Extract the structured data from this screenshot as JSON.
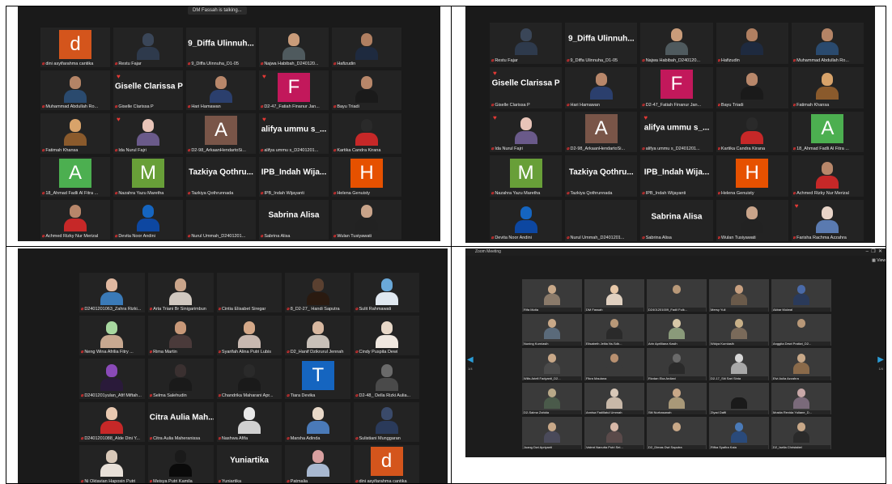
{
  "q1": {
    "talking": "DM Fassah is talking...",
    "tiles": [
      {
        "label": "dini asyifarahma cantika",
        "type": "letter",
        "letter": "d",
        "color": "#d4551c"
      },
      {
        "label": "Restu Fajar",
        "type": "photo",
        "skin": "#3a4658",
        "shirt": "#2e3a4c"
      },
      {
        "label": "9_Diffa Ulinnuha_D1-05",
        "type": "name",
        "name": "9_Diffa Ulinnuh..."
      },
      {
        "label": "Najwa Habibah_D240120...",
        "type": "photo",
        "skin": "#c99c7a",
        "shirt": "#4f5a5e"
      },
      {
        "label": "Hafizudin",
        "type": "photo",
        "skin": "#b07f61",
        "shirt": "#1e2a3f"
      },
      {
        "label": "Muhammad Abdullah Ro...",
        "type": "photo",
        "skin": "#b48466",
        "shirt": "#2a4a6e"
      },
      {
        "label": "Giselle Clarissa P",
        "type": "name",
        "name": "Giselle Clarissa P",
        "heart": true
      },
      {
        "label": "Hari Hamawan",
        "type": "photo",
        "skin": "#b8876a",
        "shirt": "#2b3f6d"
      },
      {
        "label": "D2-47_Fatiah Finanur Jan...",
        "type": "letter",
        "letter": "F",
        "color": "#c2185b",
        "heart": true
      },
      {
        "label": "Bayu Triadi",
        "type": "photo",
        "skin": "#b8876a",
        "shirt": "#1a1a1a"
      },
      {
        "label": "Fatimah Khansa",
        "type": "photo",
        "skin": "#d8a36a",
        "shirt": "#8a5a2c"
      },
      {
        "label": "Ida Nurul Fajri",
        "type": "photo",
        "skin": "#e8c4b8",
        "shirt": "#6a5a8a",
        "heart": true
      },
      {
        "label": "D2-98_ArkaanHendartoSi...",
        "type": "letter",
        "letter": "A",
        "color": "#795548"
      },
      {
        "label": "alifya ummu s_D2401201...",
        "type": "name",
        "name": "alifya ummu s_...",
        "heart": true
      },
      {
        "label": "Kartika Candra Kirana",
        "type": "photo",
        "skin": "#2a2a2a",
        "shirt": "#c62828"
      },
      {
        "label": "18_Ahmad Fadli Al Fitra ...",
        "type": "letter",
        "letter": "A",
        "color": "#4caf50"
      },
      {
        "label": "Nazahra Yazu Maretha",
        "type": "letter",
        "letter": "M",
        "color": "#689f38"
      },
      {
        "label": "Tazkiya Qothrunnada",
        "type": "name",
        "name": "Tazkiya Qothru..."
      },
      {
        "label": "IPB_Indah Wijayanti",
        "type": "name",
        "name": "IPB_Indah Wija..."
      },
      {
        "label": "Helena Genuisty",
        "type": "letter",
        "letter": "H",
        "color": "#e65100"
      },
      {
        "label": "Achmed Rizky Nur Merizal",
        "type": "photo",
        "skin": "#b8876a",
        "shirt": "#c62828"
      },
      {
        "label": "Devita Noor Andini",
        "type": "photo",
        "skin": "#1565c0",
        "shirt": "#0d47a1"
      },
      {
        "label": "Nurul Ummah_D2401201...",
        "type": "blank"
      },
      {
        "label": "Sabrina Alisa",
        "type": "name",
        "name": "Sabrina Alisa"
      },
      {
        "label": "Wulan Tusiyawati",
        "type": "photo",
        "skin": "#c9a48a",
        "shirt": "#222"
      }
    ]
  },
  "q2": {
    "tiles": [
      {
        "label": "Restu Fajar",
        "type": "photo",
        "skin": "#3a4658",
        "shirt": "#2e3a4c"
      },
      {
        "label": "9_Diffa Ulinnuha_D1-05",
        "type": "name",
        "name": "9_Diffa Ulinnuh..."
      },
      {
        "label": "Najwa Habibah_D240120...",
        "type": "photo",
        "skin": "#c99c7a",
        "shirt": "#4f5a5e"
      },
      {
        "label": "Hafizudin",
        "type": "photo",
        "skin": "#b07f61",
        "shirt": "#1e2a3f"
      },
      {
        "label": "Muhammad Abdullah Ro...",
        "type": "photo",
        "skin": "#b48466",
        "shirt": "#2a4a6e"
      },
      {
        "label": "Giselle Clarissa P",
        "type": "name",
        "name": "Giselle Clarissa P",
        "heart": true
      },
      {
        "label": "Hari Hamawan",
        "type": "photo",
        "skin": "#b8876a",
        "shirt": "#2b3f6d"
      },
      {
        "label": "D2-47_Fatiah Finanur Jan...",
        "type": "letter",
        "letter": "F",
        "color": "#c2185b"
      },
      {
        "label": "Bayu Triadi",
        "type": "photo",
        "skin": "#b8876a",
        "shirt": "#1a1a1a"
      },
      {
        "label": "Fatimah Khansa",
        "type": "photo",
        "skin": "#d8a36a",
        "shirt": "#8a5a2c"
      },
      {
        "label": "Ida Nurul Fajri",
        "type": "photo",
        "skin": "#e8c4b8",
        "shirt": "#6a5a8a",
        "heart": true
      },
      {
        "label": "D2-98_ArkaanHendartoSi...",
        "type": "letter",
        "letter": "A",
        "color": "#795548"
      },
      {
        "label": "alifya ummu s_D2401201...",
        "type": "name",
        "name": "alifya ummu s_...",
        "heart": true
      },
      {
        "label": "Kartika Candra Kirana",
        "type": "photo",
        "skin": "#2a2a2a",
        "shirt": "#c62828"
      },
      {
        "label": "18_Ahmad Fadli Al Fitra ...",
        "type": "letter",
        "letter": "A",
        "color": "#4caf50"
      },
      {
        "label": "Nazahra Yazu Maretha",
        "type": "letter",
        "letter": "M",
        "color": "#689f38"
      },
      {
        "label": "Tazkiya Qothrunnada",
        "type": "name",
        "name": "Tazkiya Qothru..."
      },
      {
        "label": "IPB_Indah Wijayanti",
        "type": "name",
        "name": "IPB_Indah Wija..."
      },
      {
        "label": "Helena Genuisty",
        "type": "letter",
        "letter": "H",
        "color": "#e65100"
      },
      {
        "label": "Achmed Rizky Nur Merizal",
        "type": "photo",
        "skin": "#b8876a",
        "shirt": "#c62828"
      },
      {
        "label": "Devita Noor Andini",
        "type": "photo",
        "skin": "#1565c0",
        "shirt": "#0d47a1"
      },
      {
        "label": "Nurul Ummah_D2401201...",
        "type": "blank"
      },
      {
        "label": "Sabrina Alisa",
        "type": "name",
        "name": "Sabrina Alisa"
      },
      {
        "label": "Wulan Tusiyawati",
        "type": "photo",
        "skin": "#c9a48a",
        "shirt": "#222"
      },
      {
        "label": "Farisha Rachma Azzahra",
        "type": "photo",
        "skin": "#e8d4c8",
        "shirt": "#5a7ab0",
        "heart": true
      }
    ]
  },
  "q3": {
    "tiles": [
      {
        "label": "D2401201063_Zahra Rizki...",
        "type": "photo",
        "skin": "#e0b8a0",
        "shirt": "#3a7ab8"
      },
      {
        "label": "Arta Triani Br Sinigarimbun",
        "type": "photo",
        "skin": "#c9a48a",
        "shirt": "#d0c8c0"
      },
      {
        "label": "Cintia Elisabet Siregar",
        "type": "blank"
      },
      {
        "label": "8_D2-27_ Handi Saputra",
        "type": "photo",
        "skin": "#5a4030",
        "shirt": "#2a1a10"
      },
      {
        "label": "Sulit Rahmawati",
        "type": "photo",
        "skin": "#6aa8d8",
        "shirt": "#e0e8f0"
      },
      {
        "label": "Neng Wina Afrilia Fitry ...",
        "type": "photo",
        "skin": "#a8d8a0",
        "shirt": "#c8a890"
      },
      {
        "label": "Rima Martin",
        "type": "photo",
        "skin": "#c89878",
        "shirt": "#4a3a3a"
      },
      {
        "label": "Syarifah Alina Putri Lubis",
        "type": "photo",
        "skin": "#d4a888",
        "shirt": "#c8b8b0"
      },
      {
        "label": "D2_Hanif Dzikrurul Jennah",
        "type": "photo",
        "skin": "#d8b8a0",
        "shirt": "#c8c0b8"
      },
      {
        "label": "Cindy Puspita Dewi",
        "type": "photo",
        "skin": "#e8d8c8",
        "shirt": "#f0e8e0"
      },
      {
        "label": "D2401201yulan_Afif Miftah...",
        "type": "photo",
        "skin": "#8a4ab8",
        "shirt": "#2a1a3a"
      },
      {
        "label": "Selma Salehudin",
        "type": "photo",
        "skin": "#3a3030",
        "shirt": "#1a1a1a"
      },
      {
        "label": "Chandrika Maharani Apr...",
        "type": "photo",
        "skin": "#2a2a2a",
        "shirt": "#1a1a1a"
      },
      {
        "label": "Tiara Devika",
        "type": "letter",
        "letter": "T",
        "color": "#1565c0"
      },
      {
        "label": "D2-48_ Della Rizki Aulia...",
        "type": "photo",
        "skin": "#6a6a6a",
        "shirt": "#4a4a4a"
      },
      {
        "label": "D2401201088_Alde Dini Y...",
        "type": "photo",
        "skin": "#e8c8b0",
        "shirt": "#c62828"
      },
      {
        "label": "Citra Aulia Maheranissa",
        "type": "name",
        "name": "Citra Aulia Mah..."
      },
      {
        "label": "Nashwa Afifa",
        "type": "photo",
        "skin": "#e8e8e8",
        "shirt": "#d0d0d0"
      },
      {
        "label": "Marsha Adinda",
        "type": "photo",
        "skin": "#e8d8c8",
        "shirt": "#4a7ab8"
      },
      {
        "label": "Sulistiani Munggaran",
        "type": "photo",
        "skin": "#3a4a6a",
        "shirt": "#2a3a5a"
      },
      {
        "label": "Ni Oktavian Haposin Putri",
        "type": "photo",
        "skin": "#d8c8b8",
        "shirt": "#e8e0d8"
      },
      {
        "label": "Meisya Putri Kamila",
        "type": "photo",
        "skin": "#1a1a1a",
        "shirt": "#0a0a0a"
      },
      {
        "label": "Yuniartika",
        "type": "name",
        "name": "Yuniartika"
      },
      {
        "label": "Patmalia",
        "type": "photo",
        "skin": "#d8a0a0",
        "shirt": "#a8b8d0"
      },
      {
        "label": "dini asyifarahma cantika",
        "type": "letter",
        "letter": "d",
        "color": "#d4551c"
      }
    ]
  },
  "q4": {
    "window_title": "Zoom Meeting",
    "view_label": "View",
    "page_left": "1/4",
    "page_right": "1/4",
    "tiles": [
      {
        "label": "Rifa Mutia",
        "skin": "#c8a888",
        "shirt": "#8a7a6a"
      },
      {
        "label": "DM Fassah",
        "skin": "#e8c8a8",
        "shirt": "#e0d0c0"
      },
      {
        "label": "D2401201009_Fadil Fulk...",
        "skin": "#b89878",
        "shirt": "#3a3a3a"
      },
      {
        "label": "Mersy Yuli",
        "skin": "#c8a080",
        "shirt": "#6a5a4a"
      },
      {
        "label": "Akbar Mulwal",
        "skin": "#4a6aa8",
        "shirt": "#2a3a5a"
      },
      {
        "label": "Nuning Kurniasih",
        "skin": "#c8a888",
        "shirt": "#5a6a7a"
      },
      {
        "label": "Elisabeth Jelita Ns.Sdb...",
        "skin": "#b89878",
        "shirt": "#2a2a2a"
      },
      {
        "label": "Arin Aprilliana Kasih",
        "skin": "#d8c8a8",
        "shirt": "#8a9a7a"
      },
      {
        "label": "Widya Kurniasih",
        "skin": "#c8b088",
        "shirt": "#7a6a5a"
      },
      {
        "label": "Anggita Dewi Pratiwi_D2...",
        "skin": "#b89878",
        "shirt": "#3a3a3a"
      },
      {
        "label": "Wilis Ariefi Fadyanti_D2...",
        "skin": "#c8a888",
        "shirt": "#4a4a4a"
      },
      {
        "label": "Fikra Maulana",
        "skin": "#b89070",
        "shirt": "#3a3a3a"
      },
      {
        "label": "Rizdan Eka Ardiani",
        "skin": "#6a6a6a",
        "shirt": "#2a2a2a"
      },
      {
        "label": "D2-17_Siti Sari Sinta",
        "skin": "#d8d8d8",
        "shirt": "#a8a8a8"
      },
      {
        "label": "Elvi Aulia Azzahra",
        "skin": "#c8a888",
        "shirt": "#8a6a4a"
      },
      {
        "label": "D2-Salma Zahida",
        "skin": "#b8a888",
        "shirt": "#4a5a4a"
      },
      {
        "label": "Annisa Fadillatul Ummah",
        "skin": "#d8c8b8",
        "shirt": "#c8b8a8"
      },
      {
        "label": "Siti Nurhasanah",
        "skin": "#c8a888",
        "shirt": "#a89878"
      },
      {
        "label": "Ziyad Daffi",
        "skin": "#3a3a3a",
        "shirt": "#1a1a1a"
      },
      {
        "label": "Mosita Revida Yuliane_D...",
        "skin": "#c8a8a8",
        "shirt": "#7a6a7a"
      },
      {
        "label": "Juang Dwi Apriyanti",
        "skin": "#c8a888",
        "shirt": "#4a4a5a"
      },
      {
        "label": "Valent Nanutta Putri Sei...",
        "skin": "#d8b8a8",
        "shirt": "#5a4a4a"
      },
      {
        "label": "D2_Dimas Dwi Saputra",
        "skin": "#c8a888",
        "shirt": "#3a3a3a"
      },
      {
        "label": "Rifka Syafira Kaia",
        "skin": "#4a7ab8",
        "shirt": "#2a4a7a"
      },
      {
        "label": "D2_Isella Christabel",
        "skin": "#c8a888",
        "shirt": "#2a2a2a"
      }
    ]
  }
}
